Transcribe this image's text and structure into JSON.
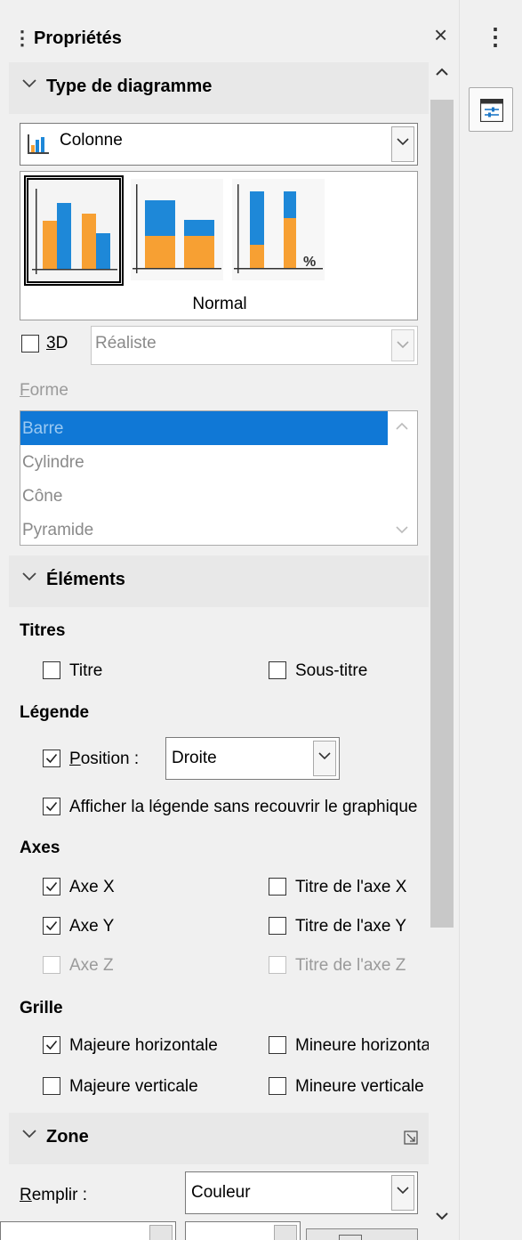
{
  "panel": {
    "title": "Propriétés",
    "close_glyph": "×",
    "grip_glyph": "⋮"
  },
  "right_strip": {
    "menu_glyph": "⋮",
    "properties_deck_icon": "properties-deck-icon"
  },
  "chart_type": {
    "header": "Type de diagramme",
    "type_select": {
      "value": "Colonne",
      "icon": "column-chart-icon"
    },
    "variants": [
      "normal-column",
      "stacked-column",
      "percent-stacked-column"
    ],
    "selected_variant_label": "Normal",
    "percent_mark": "%",
    "three_d": {
      "checked": false,
      "label": "3D",
      "mnemonic": "3"
    },
    "three_d_style": {
      "value": "Réaliste",
      "disabled": true
    },
    "shape_label": "Forme",
    "shapes": [
      "Barre",
      "Cylindre",
      "Cône",
      "Pyramide"
    ],
    "selected_shape": "Barre"
  },
  "elements": {
    "header": "Éléments",
    "titles": {
      "group": "Titres",
      "title": {
        "label": "Titre",
        "checked": false
      },
      "subtitle": {
        "label": "Sous-titre",
        "checked": false
      }
    },
    "legend": {
      "group": "Légende",
      "position": {
        "label": "Position :",
        "checked": true,
        "value": "Droite"
      },
      "no_overlap": {
        "label": "Afficher la légende sans recouvrir le graphique",
        "checked": true
      }
    },
    "axes": {
      "group": "Axes",
      "x": {
        "label": "Axe X",
        "checked": true
      },
      "y": {
        "label": "Axe Y",
        "checked": true
      },
      "z": {
        "label": "Axe Z",
        "checked": false,
        "disabled": true
      },
      "x_title": {
        "label": "Titre de l'axe X",
        "checked": false
      },
      "y_title": {
        "label": "Titre de l'axe Y",
        "checked": false
      },
      "z_title": {
        "label": "Titre de l'axe Z",
        "checked": false,
        "disabled": true
      }
    },
    "grid": {
      "group": "Grille",
      "major_h": {
        "label": "Majeure horizontale",
        "checked": true
      },
      "minor_h": {
        "label": "Mineure horizontale",
        "checked": false
      },
      "major_v": {
        "label": "Majeure verticale",
        "checked": false
      },
      "minor_v": {
        "label": "Mineure verticale",
        "checked": false
      }
    }
  },
  "area": {
    "header": "Zone",
    "fill_label": "Remplir :",
    "fill_value": "Couleur"
  },
  "colors": {
    "series_blue": "#1e88d8",
    "series_orange": "#f7a033",
    "selection_blue": "#1078d6"
  }
}
